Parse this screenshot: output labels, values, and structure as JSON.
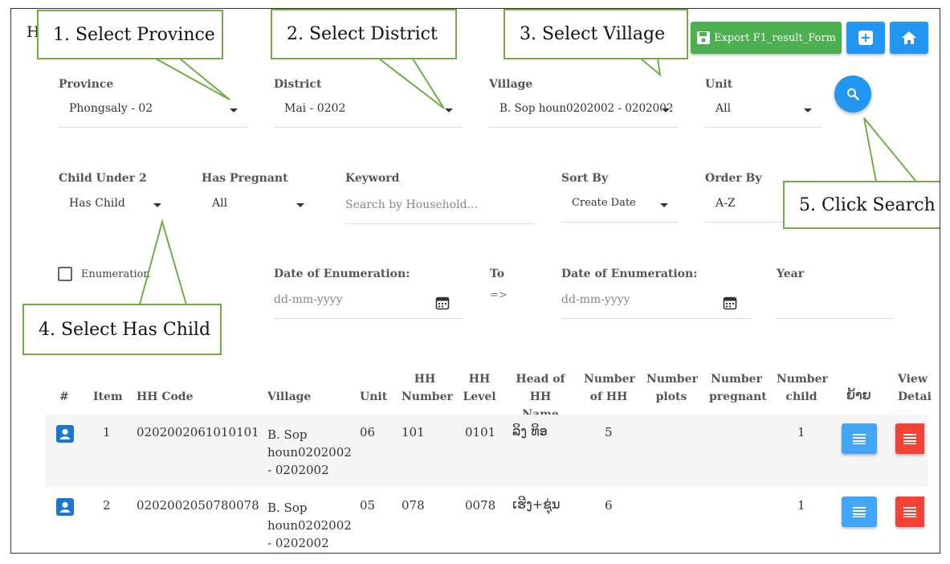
{
  "page": {
    "title": "H"
  },
  "toolbar": {
    "export_label": "Export F1_result_Form",
    "add_icon": "plus-square-icon",
    "home_icon": "home-icon"
  },
  "filters": {
    "province": {
      "label": "Province",
      "value": "Phongsaly - 02"
    },
    "district": {
      "label": "District",
      "value": "Mai - 0202"
    },
    "village": {
      "label": "Village",
      "value": "B. Sop houn0202002 - 0202002"
    },
    "unit": {
      "label": "Unit",
      "value": "All"
    },
    "child_under": {
      "label": "Child Under 2",
      "value": "Has Child"
    },
    "has_pregnant": {
      "label": "Has Pregnant",
      "value": "All"
    },
    "keyword": {
      "label": "Keyword",
      "placeholder": "Search by Household..."
    },
    "sort_by": {
      "label": "Sort By",
      "value": "Create Date"
    },
    "order_by": {
      "label": "Order By",
      "value": "A-Z"
    },
    "enumeration": {
      "label": "Enumeration"
    },
    "date_from": {
      "label": "Date of Enumeration:",
      "placeholder": "dd-mm-yyyy"
    },
    "to": {
      "label": "To",
      "arrow": "=>"
    },
    "date_to": {
      "label": "Date of Enumeration:",
      "placeholder": "dd-mm-yyyy"
    },
    "year": {
      "label": "Year"
    }
  },
  "callouts": {
    "c1": "1. Select Province",
    "c2": "2. Select District",
    "c3": "3. Select Village",
    "c4": "4. Select Has Child",
    "c5": "5. Click Search"
  },
  "table": {
    "headers": {
      "hash": "#",
      "item": "Item",
      "hh_code": "HH Code",
      "village": "Village",
      "unit": "Unit",
      "hh_number_1": "HH",
      "hh_number_2": "Number",
      "hh_level_1": "HH",
      "hh_level_2": "Level",
      "head_1": "Head of",
      "head_2": "HH Name",
      "num_hh_1": "Number",
      "num_hh_2": "of HH",
      "num_plots_1": "Number",
      "num_plots_2": "plots",
      "num_preg_1": "Number",
      "num_preg_2": "pregnant",
      "num_child_1": "Number",
      "num_child_2": "child",
      "move": "ຍ້າຍ",
      "view_1": "View",
      "view_2": "Detai"
    },
    "rows": [
      {
        "item": "1",
        "hh_code": "0202002061010101",
        "village_1": "B. Sop",
        "village_2": "houn0202002",
        "village_3": "- 0202002",
        "unit": "06",
        "hh_number": "101",
        "hh_level": "0101",
        "head": "ລິງ ທິອ",
        "num_hh": "5",
        "num_child": "1"
      },
      {
        "item": "2",
        "hh_code": "0202002050780078",
        "village_1": "B. Sop",
        "village_2": "houn0202002",
        "village_3": "- 0202002",
        "unit": "05",
        "hh_number": "078",
        "hh_level": "0078",
        "head": "ເຮີງ+ຊຸ່ນ",
        "num_hh": "6",
        "num_child": "1"
      }
    ]
  },
  "colors": {
    "accent": "#2196f3",
    "export": "#4caf50",
    "danger": "#f44336",
    "callout_border": "#70ad47"
  }
}
